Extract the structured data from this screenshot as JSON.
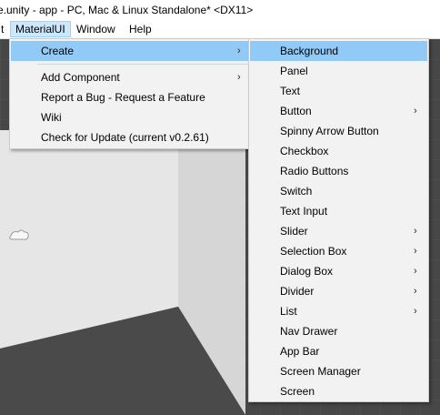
{
  "window": {
    "title": "e.unity - app - PC, Mac & Linux Standalone* <DX11>"
  },
  "menubar": {
    "items": [
      {
        "label": "t"
      },
      {
        "label": "MaterialUI"
      },
      {
        "label": "Window"
      },
      {
        "label": "Help"
      }
    ]
  },
  "materialui_menu": {
    "items": [
      {
        "label": "Create",
        "submenu": true
      },
      {
        "label": "Add Component",
        "submenu": true
      },
      {
        "label": "Report a Bug - Request a Feature"
      },
      {
        "label": "Wiki"
      },
      {
        "label": "Check for Update (current v0.2.61)"
      }
    ]
  },
  "create_menu": {
    "items": [
      {
        "label": "Background",
        "submenu": false
      },
      {
        "label": "Panel",
        "submenu": false
      },
      {
        "label": "Text",
        "submenu": false
      },
      {
        "label": "Button",
        "submenu": true
      },
      {
        "label": "Spinny Arrow Button",
        "submenu": false
      },
      {
        "label": "Checkbox",
        "submenu": false
      },
      {
        "label": "Radio Buttons",
        "submenu": false
      },
      {
        "label": "Switch",
        "submenu": false
      },
      {
        "label": "Text Input",
        "submenu": false
      },
      {
        "label": "Slider",
        "submenu": true
      },
      {
        "label": "Selection Box",
        "submenu": true
      },
      {
        "label": "Dialog Box",
        "submenu": true
      },
      {
        "label": "Divider",
        "submenu": true
      },
      {
        "label": "List",
        "submenu": true
      },
      {
        "label": "Nav Drawer",
        "submenu": false
      },
      {
        "label": "App Bar",
        "submenu": false
      },
      {
        "label": "Screen Manager",
        "submenu": false
      },
      {
        "label": "Screen",
        "submenu": false
      }
    ]
  },
  "glyphs": {
    "submenu_arrow": "›"
  },
  "colors": {
    "highlight": "#91c9f7",
    "menubar_active": "#cce8ff",
    "scene_bg": "#474747"
  }
}
